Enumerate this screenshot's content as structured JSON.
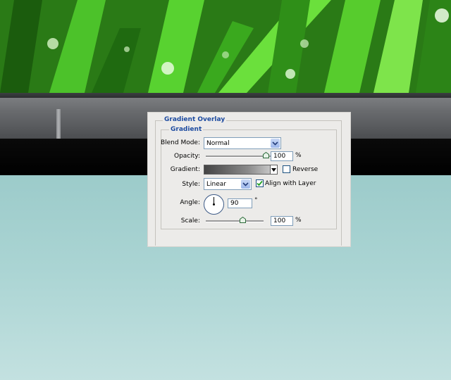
{
  "dialog": {
    "section_title": "Gradient Overlay",
    "group_title": "Gradient",
    "blend_mode": {
      "label": "Blend Mode:",
      "value": "Normal"
    },
    "opacity": {
      "label": "Opacity:",
      "value": "100",
      "unit": "%",
      "level": 1.0
    },
    "gradient": {
      "label": "Gradient:"
    },
    "reverse": {
      "label": "Reverse",
      "checked": false
    },
    "style": {
      "label": "Style:",
      "value": "Linear"
    },
    "align_with_layer": {
      "label": "Align with Layer",
      "checked": true
    },
    "angle": {
      "label": "Angle:",
      "value": "90",
      "unit": "°"
    },
    "scale": {
      "label": "Scale:",
      "value": "100",
      "unit": "%",
      "level": 0.6
    }
  },
  "colors": {
    "legend": "#1d4ba0",
    "dialog_bg": "#ecebe9",
    "teal_bg": "#a6d3d3",
    "checkbox_mark": "#21a121"
  },
  "icons": [
    "chevron-down-icon",
    "checkmark-icon",
    "slider-thumb-icon"
  ]
}
